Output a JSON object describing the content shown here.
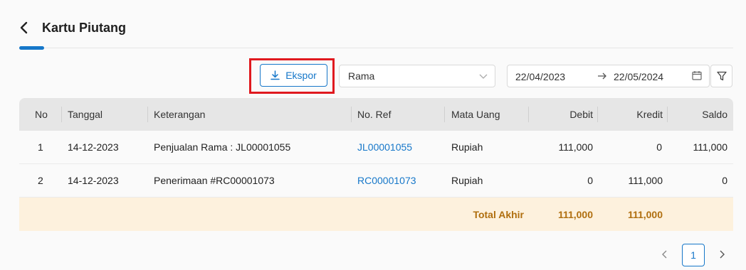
{
  "page": {
    "title": "Kartu Piutang"
  },
  "toolbar": {
    "export_label": "Ekspor",
    "customer_select_value": "Rama",
    "date_start": "22/04/2023",
    "date_end": "22/05/2024"
  },
  "table": {
    "headers": {
      "no": "No",
      "date": "Tanggal",
      "description": "Keterangan",
      "ref": "No. Ref",
      "currency": "Mata Uang",
      "debit": "Debit",
      "credit": "Kredit",
      "balance": "Saldo"
    },
    "rows": [
      {
        "no": "1",
        "date": "14-12-2023",
        "description": "Penjualan Rama : JL00001055",
        "ref": "JL00001055",
        "currency": "Rupiah",
        "debit": "111,000",
        "credit": "0",
        "balance": "111,000"
      },
      {
        "no": "2",
        "date": "14-12-2023",
        "description": "Penerimaan #RC00001073",
        "ref": "RC00001073",
        "currency": "Rupiah",
        "debit": "0",
        "credit": "111,000",
        "balance": "0"
      }
    ],
    "total": {
      "label": "Total Akhir",
      "debit": "111,000",
      "credit": "111,000"
    }
  },
  "pagination": {
    "current_page": "1"
  },
  "colors": {
    "accent": "#1677c9",
    "highlight": "#e0191f",
    "total_row_bg": "#fdf1dd",
    "total_text": "#b06f0f"
  },
  "icons": [
    "chevron-left-icon",
    "download-icon",
    "chevron-down-icon",
    "arrow-right-icon",
    "calendar-icon",
    "filter-icon",
    "chevron-right-icon"
  ]
}
